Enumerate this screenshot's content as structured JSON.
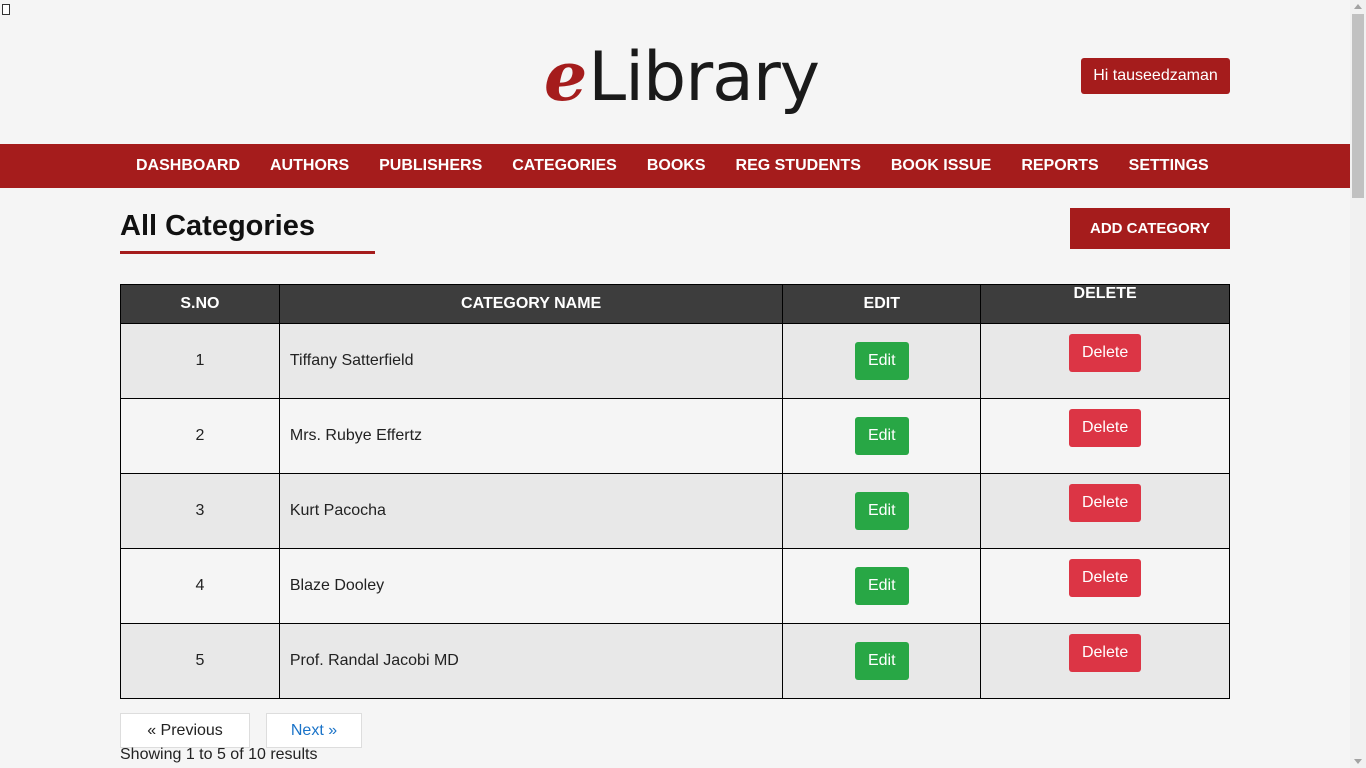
{
  "header": {
    "logo_e": "e",
    "logo_rest": "Library",
    "user_greeting": "Hi tauseedzaman"
  },
  "nav": {
    "items": [
      "DASHBOARD",
      "AUTHORS",
      "PUBLISHERS",
      "CATEGORIES",
      "BOOKS",
      "REG STUDENTS",
      "BOOK ISSUE",
      "REPORTS",
      "SETTINGS"
    ]
  },
  "main": {
    "title": "All Categories",
    "add_button": "ADD CATEGORY"
  },
  "table": {
    "headers": [
      "S.NO",
      "CATEGORY NAME",
      "EDIT",
      "DELETE"
    ],
    "edit_label": "Edit",
    "delete_label": "Delete",
    "rows": [
      {
        "sno": "1",
        "name": "Tiffany Satterfield"
      },
      {
        "sno": "2",
        "name": "Mrs. Rubye Effertz"
      },
      {
        "sno": "3",
        "name": "Kurt Pacocha"
      },
      {
        "sno": "4",
        "name": "Blaze Dooley"
      },
      {
        "sno": "5",
        "name": "Prof. Randal Jacobi MD"
      }
    ]
  },
  "pagination": {
    "previous": "« Previous",
    "next": "Next »",
    "summary": "Showing 1 to 5 of 10 results"
  },
  "colors": {
    "brand": "#a51c1c",
    "edit": "#28a745",
    "delete": "#dc3545",
    "table_header": "#3d3d3d"
  }
}
